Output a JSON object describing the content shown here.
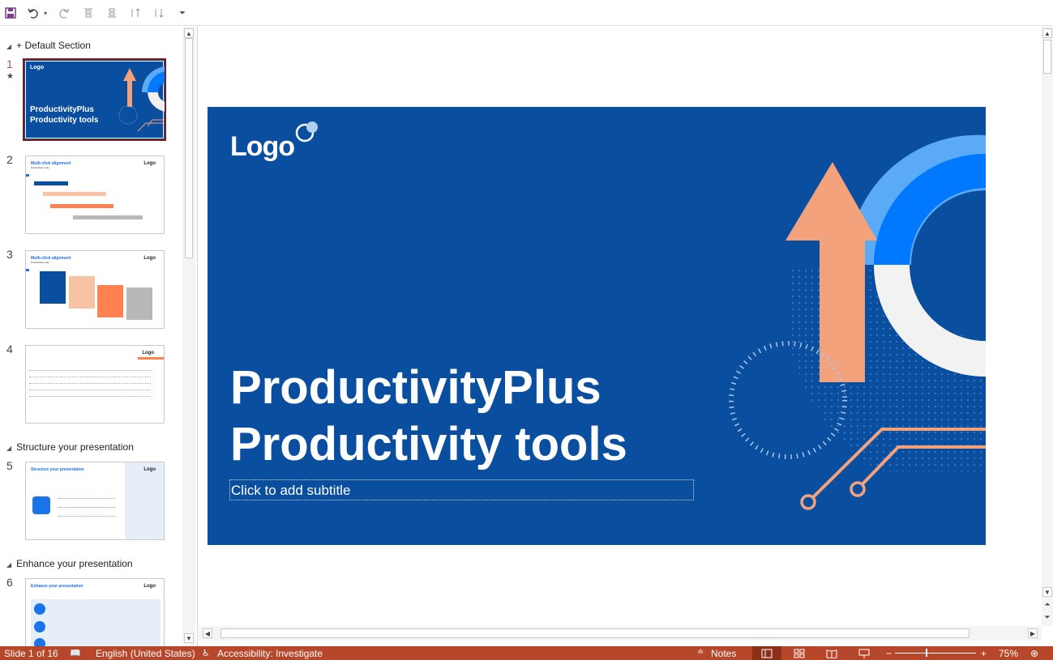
{
  "toolbar": {
    "icons": [
      "save-icon",
      "undo-icon",
      "undo-dropdown-icon",
      "redo-icon",
      "align-top-icon",
      "align-bottom-icon",
      "sort-ascending-icon",
      "sort-descending-icon",
      "customize-toolbar-icon"
    ]
  },
  "thumbnail_pane": {
    "sections": [
      {
        "label": "+ Default Section"
      },
      {
        "label": "Structure your presentation"
      },
      {
        "label": "Enhance your presentation"
      }
    ],
    "slides": [
      {
        "number": "1",
        "title": "ProductivityPlus",
        "subtitle": "Productivity tools",
        "logo": "Logo",
        "star": "★"
      },
      {
        "number": "2",
        "title": "Multi-click alignment",
        "sub": "Productivity tools",
        "logo": "Logo"
      },
      {
        "number": "3",
        "title": "Multi-click alignment",
        "sub": "Productivity tools",
        "logo": "Logo"
      },
      {
        "number": "4",
        "logo": "Logo"
      },
      {
        "number": "5",
        "title": "Structure your presentation",
        "logo": "Logo"
      },
      {
        "number": "6",
        "title": "Enhance your presentation",
        "logo": "Logo"
      }
    ]
  },
  "slide": {
    "logo": "Logo",
    "title_line1": "ProductivityPlus",
    "title_line2": "Productivity tools",
    "subtitle_placeholder": "Click to add subtitle",
    "colors": {
      "background": "#0a4ea0",
      "accent_orange": "#f4a27c",
      "accent_blue": "#0078ff",
      "light_blue": "#5aaaf5"
    }
  },
  "status_bar": {
    "slide_counter": "Slide 1 of 16",
    "language": "English (United States)",
    "accessibility": "Accessibility: Investigate",
    "notes": "Notes",
    "zoom_minus": "−",
    "zoom_plus": "+",
    "zoom": "75%",
    "zoom_fraction": 0.3
  }
}
